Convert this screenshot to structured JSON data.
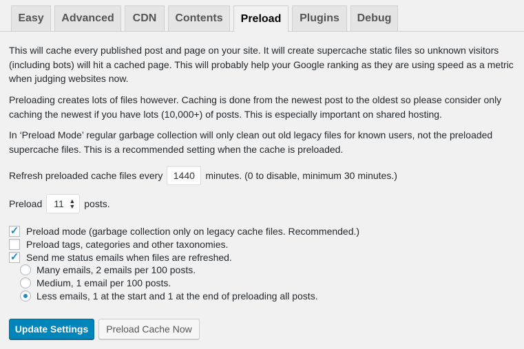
{
  "tabs": [
    "Easy",
    "Advanced",
    "CDN",
    "Contents",
    "Preload",
    "Plugins",
    "Debug"
  ],
  "active_tab": "Preload",
  "paragraphs": [
    "This will cache every published post and page on your site. It will create supercache static files so unknown visitors (including bots) will hit a cached page. This will probably help your Google ranking as they are using speed as a metric when judging websites now.",
    "Preloading creates lots of files however. Caching is done from the newest post to the oldest so please consider only caching the newest if you have lots (10,000+) of posts. This is especially important on shared hosting.",
    "In ‘Preload Mode’ regular garbage collection will only clean out old legacy files for known users, not the preloaded supercache files. This is a recommended setting when the cache is preloaded."
  ],
  "refresh": {
    "label_before": "Refresh preloaded cache files every",
    "value": "1440",
    "label_after": "minutes. (0 to disable, minimum 30 minutes.)"
  },
  "preload_count": {
    "label_before": "Preload",
    "value": "11",
    "label_after": "posts."
  },
  "checkboxes": [
    {
      "label": "Preload mode (garbage collection only on legacy cache files. Recommended.)",
      "checked": true
    },
    {
      "label": "Preload tags, categories and other taxonomies.",
      "checked": false
    },
    {
      "label": "Send me status emails when files are refreshed.",
      "checked": true
    }
  ],
  "email_options": [
    {
      "label": "Many emails, 2 emails per 100 posts.",
      "selected": false
    },
    {
      "label": "Medium, 1 email per 100 posts.",
      "selected": false
    },
    {
      "label": "Less emails, 1 at the start and 1 at the end of preloading all posts.",
      "selected": true
    }
  ],
  "buttons": {
    "update": "Update Settings",
    "preload_now": "Preload Cache Now"
  },
  "colors": {
    "primary": "#0085ba",
    "check": "#1e8cbe",
    "background": "#f1f1f1"
  }
}
